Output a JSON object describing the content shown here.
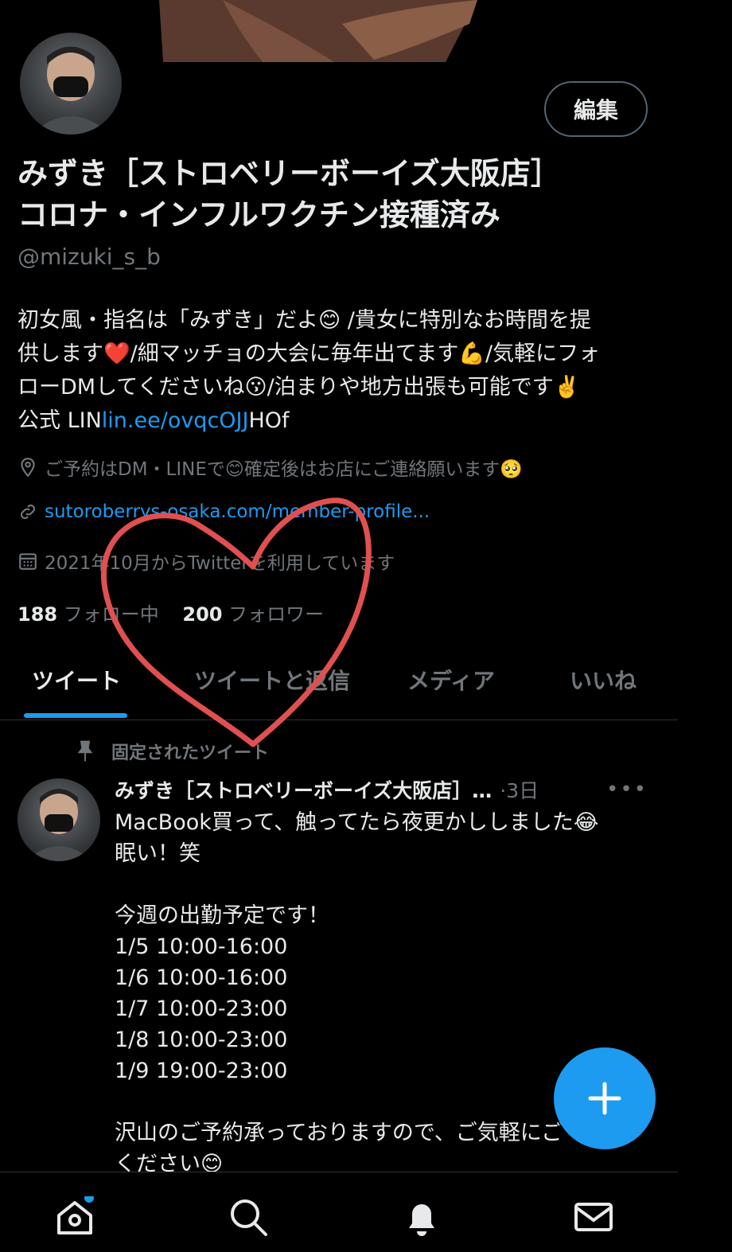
{
  "profile": {
    "edit_label": "編集",
    "name_line1": "みずき［ストロベリーボーイズ大阪店］",
    "name_line2": "コロナ・インフルワクチン接種済み",
    "handle": "@mizuki_s_b",
    "bio_line1": "初女風・指名は「みずき」だよ😊 /貴女に特別なお時間を提",
    "bio_line2": "供します❤️/細マッチョの大会に毎年出てます💪/気軽にフォ",
    "bio_line3": "ローDMしてくださいね😗/泊まりや地方出張も可能です✌️",
    "bio_prefix": "公式 LIN",
    "bio_link": "lin.ee/ovqcOJJ",
    "bio_suffix": "HOf",
    "location": "ご予約はDM・LINEで😊確定後はお店にご連絡願います🥺",
    "website": "sutoroberrys-osaka.com/member-profile...",
    "joined": "2021年10月からTwitterを利用しています",
    "following_count": "188",
    "following_label": "フォロー中",
    "followers_count": "200",
    "followers_label": "フォロワー"
  },
  "tabs": [
    "ツイート",
    "ツイートと返信",
    "メディア",
    "いいね"
  ],
  "tweet": {
    "pinned_label": "固定されたツイート",
    "author": "みずき［ストロベリーボーイズ大阪店］…",
    "time": "·3日",
    "more": "•••",
    "body": "MacBook買って、触ってたら夜更かししました😂\n眠い！笑\n\n今週の出勤予定です！\n1/5 10:00-16:00\n1/6 10:00-16:00\n1/7 10:00-23:00\n1/8 10:00-23:00\n1/9 19:00-23:00\n\n沢山のご予約承っておりますので、ご気軽にご\nください😊"
  },
  "colors": {
    "accent": "#1d9bf0",
    "background": "#000000",
    "muted": "#71767b",
    "heart": "#e05050"
  },
  "icons": [
    "location-icon",
    "link-icon",
    "calendar-icon",
    "pin-icon",
    "compose-icon",
    "home-icon",
    "search-icon",
    "bell-icon",
    "mail-icon"
  ]
}
